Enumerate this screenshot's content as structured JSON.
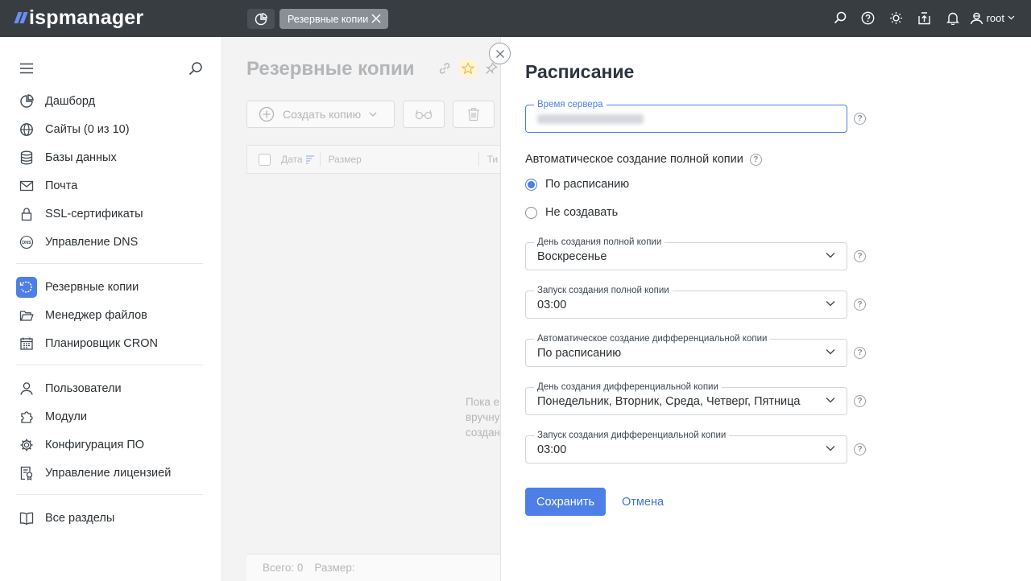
{
  "app": {
    "logo_text": "ispmanager",
    "user": "root"
  },
  "topbar": {
    "tab_label": "Резервные копии"
  },
  "sidebar": {
    "items": [
      {
        "label": "Дашборд",
        "icon": "dashboard-icon"
      },
      {
        "label": "Сайты (0 из 10)",
        "icon": "globe-icon"
      },
      {
        "label": "Базы данных",
        "icon": "database-icon"
      },
      {
        "label": "Почта",
        "icon": "mail-icon"
      },
      {
        "label": "SSL-сертификаты",
        "icon": "lock-icon"
      },
      {
        "label": "Управление DNS",
        "icon": "dns-icon"
      },
      {
        "label": "Резервные копии",
        "icon": "backup-icon"
      },
      {
        "label": "Менеджер файлов",
        "icon": "folder-icon"
      },
      {
        "label": "Планировщик CRON",
        "icon": "calendar-icon"
      },
      {
        "label": "Пользователи",
        "icon": "user-icon"
      },
      {
        "label": "Модули",
        "icon": "puzzle-icon"
      },
      {
        "label": "Конфигурация ПО",
        "icon": "gear-icon"
      },
      {
        "label": "Управление лицензией",
        "icon": "license-icon"
      },
      {
        "label": "Все разделы",
        "icon": "book-icon"
      }
    ]
  },
  "main": {
    "title": "Резервные копии",
    "create_button": "Создать копию",
    "columns": {
      "date": "Дата",
      "size": "Размер",
      "type": "Ти"
    },
    "empty_text": "Пока е\nвручну\nсоздан",
    "footer": {
      "total": "Всего: 0",
      "size": "Размер:"
    }
  },
  "panel": {
    "title": "Расписание",
    "server_time_label": "Время сервера",
    "auto_full_label": "Автоматическое создание полной копии",
    "radio_schedule": "По расписанию",
    "radio_none": "Не создавать",
    "fields": {
      "full_day": {
        "label": "День создания полной копии",
        "value": "Воскресенье"
      },
      "full_time": {
        "label": "Запуск создания полной копии",
        "value": "03:00"
      },
      "diff_auto": {
        "label": "Автоматическое создание дифференциальной копии",
        "value": "По расписанию"
      },
      "diff_day": {
        "label": "День создания дифференциальной копии",
        "value": "Понедельник, Вторник, Среда, Четверг, Пятница"
      },
      "diff_time": {
        "label": "Запуск создания дифференциальной копии",
        "value": "03:00"
      }
    },
    "save": "Сохранить",
    "cancel": "Отмена"
  },
  "colors": {
    "accent": "#4d7fe6",
    "topbar": "#383d42"
  }
}
